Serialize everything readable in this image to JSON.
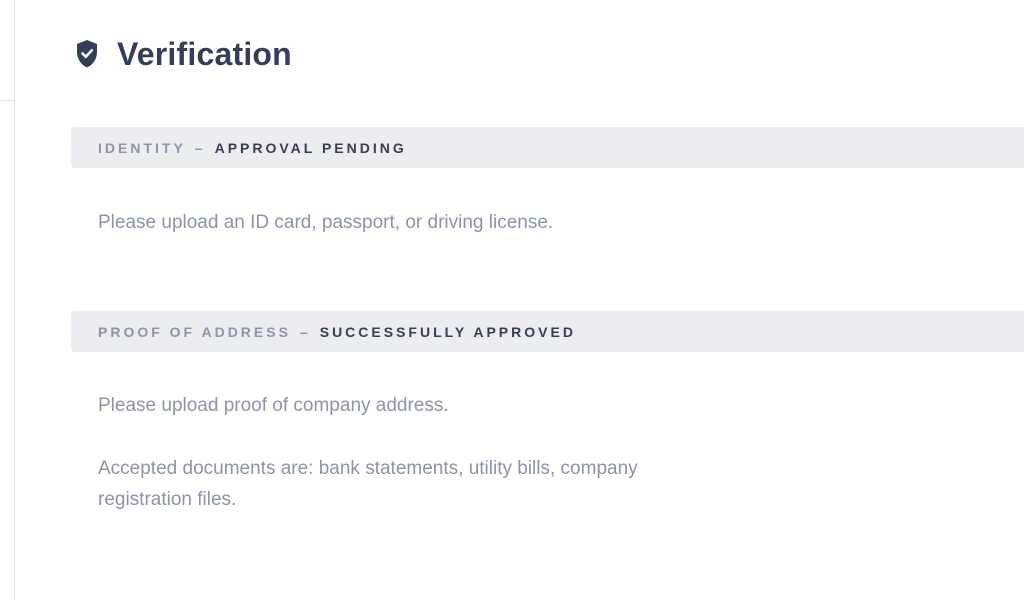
{
  "header": {
    "title": "Verification",
    "icon": "shield-check-icon"
  },
  "sections": [
    {
      "name": "IDENTITY",
      "separator": "–",
      "status": "APPROVAL PENDING",
      "paragraphs": [
        "Please upload an ID card, passport, or driving license."
      ]
    },
    {
      "name": "PROOF OF ADDRESS",
      "separator": "–",
      "status": "SUCCESSFULLY APPROVED",
      "paragraphs": [
        "Please upload proof of company address.",
        "Accepted documents are: bank statements, utility bills, company registration files."
      ]
    }
  ],
  "colors": {
    "title": "#333f59",
    "muted": "#8a95ab",
    "bar": "#ecedf0"
  }
}
